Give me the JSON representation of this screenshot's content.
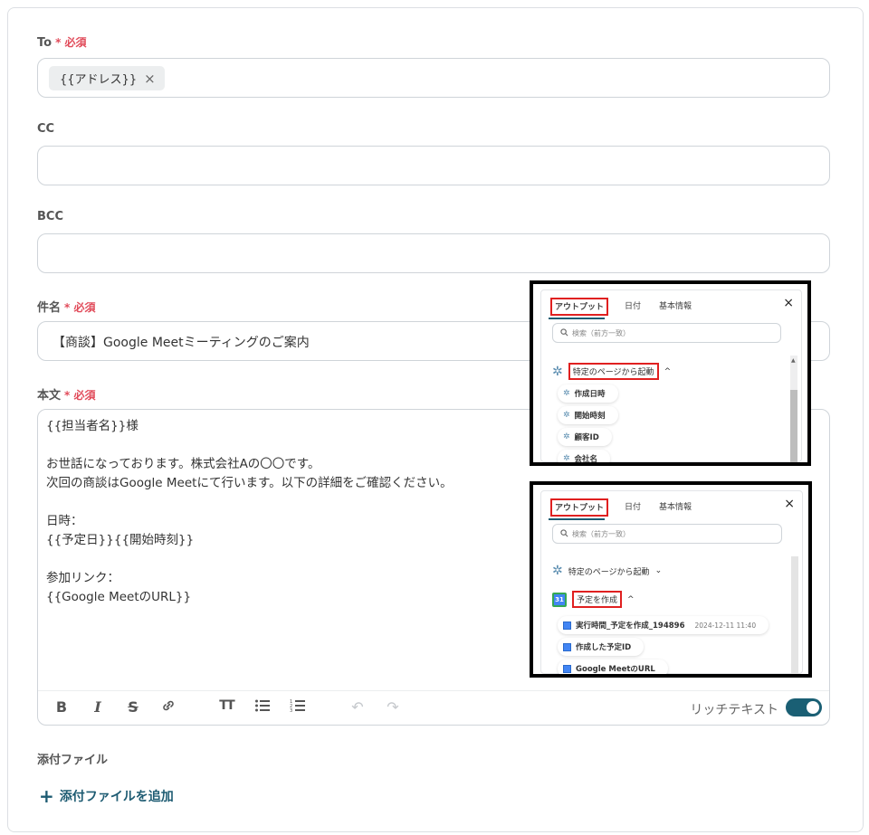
{
  "to": {
    "label": "To",
    "required": "必須",
    "chip": "{{アドレス}}",
    "chip_remove": "×"
  },
  "cc": {
    "label": "CC"
  },
  "bcc": {
    "label": "BCC"
  },
  "subject": {
    "label": "件名",
    "required": "必須",
    "value": "【商談】Google Meetミーティングのご案内"
  },
  "body": {
    "label": "本文",
    "required": "必須",
    "lines": [
      "{{担当者名}}様",
      "",
      "お世話になっております。株式会社Aの〇〇です。",
      "次回の商談はGoogle Meetにて行います。以下の詳細をご確認ください。",
      "",
      "日時：",
      "{{予定日}}{{開始時刻}}",
      "",
      "参加リンク：",
      "{{Google MeetのURL}}"
    ]
  },
  "toolbar": {
    "bold": "B",
    "italic": "I",
    "strike": "S",
    "link": "🔗",
    "text_size": "TT",
    "bullet_list": "☰",
    "numbered_list": "☰",
    "undo": "↶",
    "redo": "↷",
    "rich_text_label": "リッチテキスト",
    "rich_text_on": true
  },
  "attachment": {
    "label": "添付ファイル",
    "add_button": "添付ファイルを追加",
    "plus": "+"
  },
  "panel1": {
    "tabs": [
      "アウトプット",
      "日付",
      "基本情報"
    ],
    "close": "×",
    "search_placeholder": "検索（前方一致）",
    "group": "特定のページから起動",
    "items": [
      "作成日時",
      "開始時刻",
      "顧客ID",
      "会社名"
    ]
  },
  "panel2": {
    "tabs": [
      "アウトプット",
      "日付",
      "基本情報"
    ],
    "close": "×",
    "search_placeholder": "検索（前方一致）",
    "group1": "特定のページから起動",
    "group2": "予定を作成",
    "gcal_badge": "31",
    "items": [
      {
        "label": "実行時間_予定を作成_194896",
        "timestamp": "2024-12-11 11:40"
      },
      {
        "label": "作成した予定ID",
        "timestamp": ""
      },
      {
        "label": "Google MeetのURL",
        "timestamp": ""
      }
    ]
  }
}
